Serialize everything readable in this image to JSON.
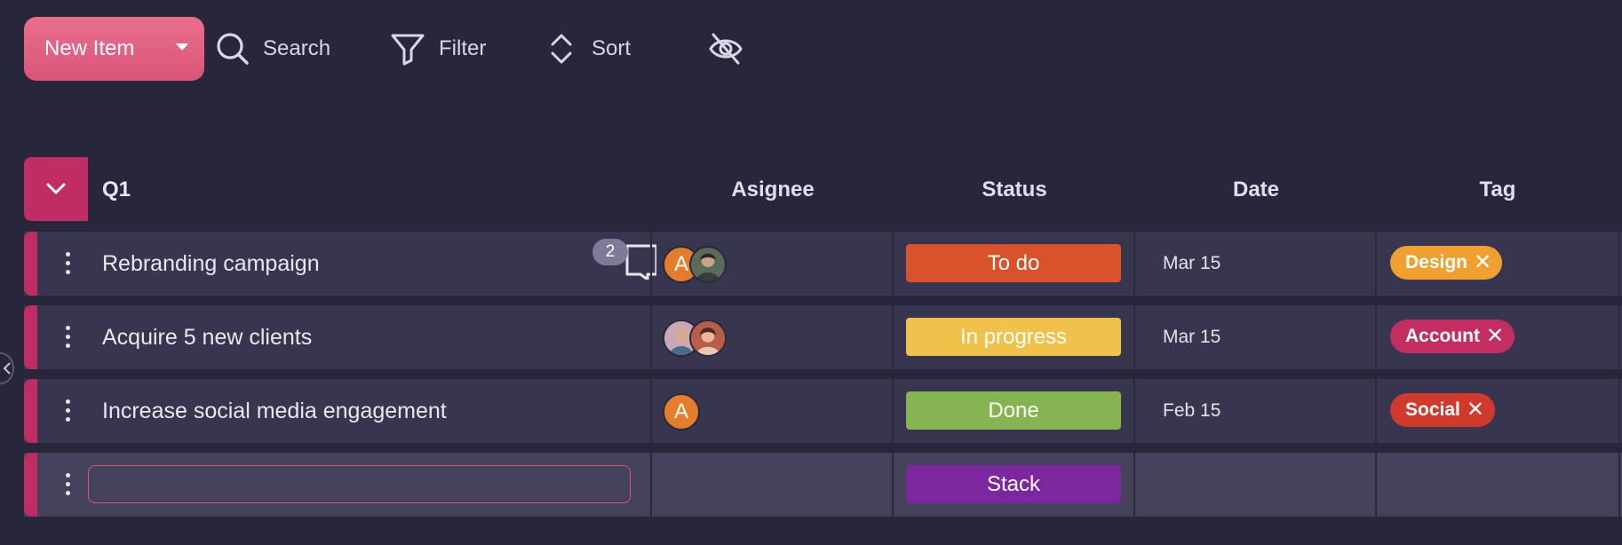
{
  "toolbar": {
    "new_item": "New Item",
    "search": "Search",
    "filter": "Filter",
    "sort": "Sort",
    "hide_icon": "eye-off-icon"
  },
  "group": {
    "title": "Q1",
    "accent_color": "#bf2d63",
    "columns": [
      "Asignee",
      "Status",
      "Date",
      "Tag"
    ]
  },
  "rows": [
    {
      "title": "Rebranding campaign",
      "comments": "2",
      "assignees": [
        {
          "initial": "A",
          "color": "#e47e2c"
        },
        {
          "initial": "",
          "color": "#5b6b5a"
        }
      ],
      "status": "To do",
      "status_color": "#d8532c",
      "date": "Mar 15",
      "tag": "Design",
      "tag_color": "#f0a030"
    },
    {
      "title": "Acquire 5 new clients",
      "assignees": [
        {
          "initial": "",
          "color": "#8a7c8e"
        },
        {
          "initial": "",
          "color": "#b46a5e"
        }
      ],
      "status": "In progress",
      "status_color": "#f1c24a",
      "date": "Mar 15",
      "tag": "Account",
      "tag_color": "#c42d62"
    },
    {
      "title": "Increase social media engagement",
      "assignees": [
        {
          "initial": "A",
          "color": "#e47e2c"
        }
      ],
      "status": "Done",
      "status_color": "#86b452",
      "date": "Feb 15",
      "tag": "Social",
      "tag_color": "#d03a2c"
    },
    {
      "title": "",
      "status": "Stack",
      "status_color": "#7b28a0"
    }
  ]
}
